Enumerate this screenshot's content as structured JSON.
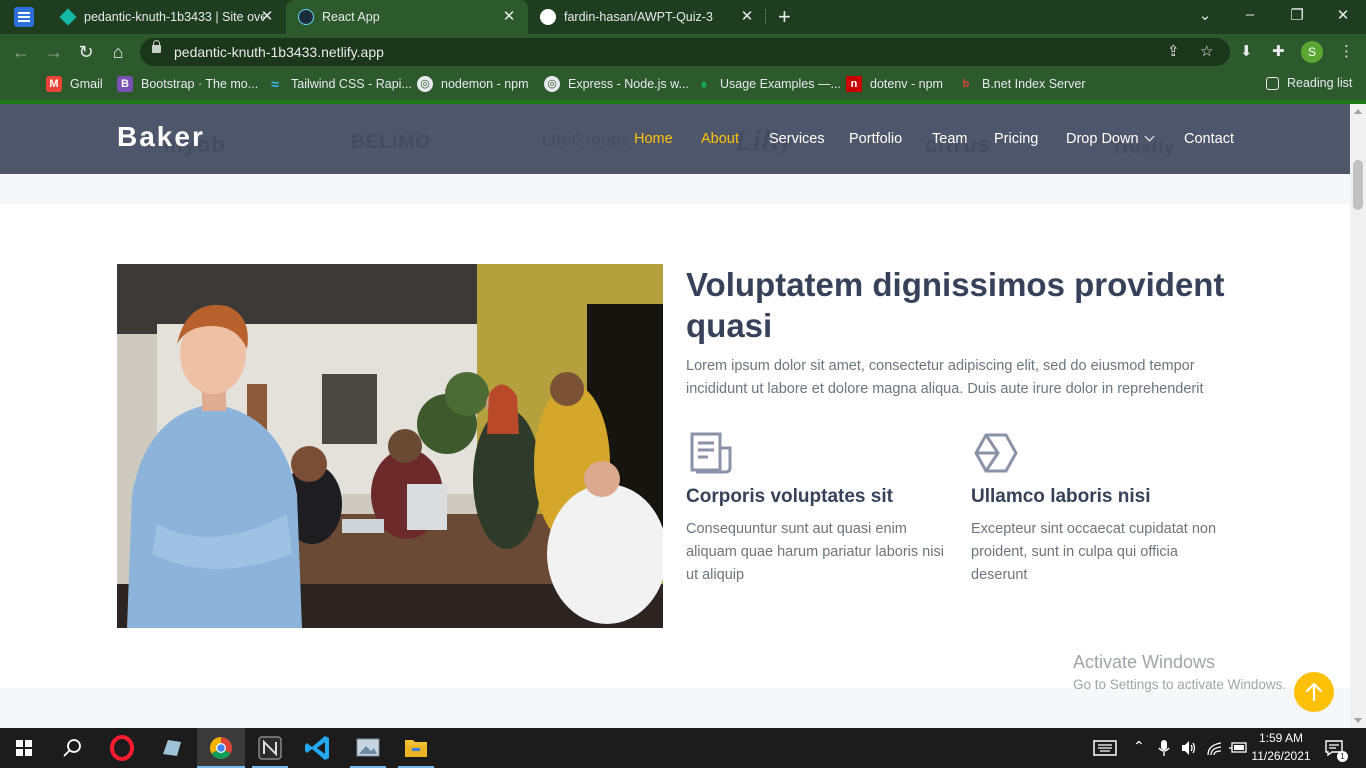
{
  "browser": {
    "tabs": [
      {
        "title": "pedantic-knuth-1b3433 | Site ove",
        "favicon": "netlify-icon",
        "active": false
      },
      {
        "title": "React App",
        "favicon": "react-icon",
        "active": true
      },
      {
        "title": "fardin-hasan/AWPT-Quiz-3",
        "favicon": "github-icon",
        "active": false
      }
    ],
    "url": "pedantic-knuth-1b3433.netlify.app",
    "profile_initial": "S",
    "bookmarks": [
      {
        "label": "Gmail",
        "icon": "gmail-icon"
      },
      {
        "label": "Bootstrap · The mo...",
        "icon": "bootstrap-icon"
      },
      {
        "label": "Tailwind CSS - Rapi...",
        "icon": "tailwind-icon"
      },
      {
        "label": "nodemon - npm",
        "icon": "globe-icon"
      },
      {
        "label": "Express - Node.js w...",
        "icon": "globe-icon"
      },
      {
        "label": "Usage Examples —...",
        "icon": "leaf-icon"
      },
      {
        "label": "dotenv - npm",
        "icon": "npm-icon"
      },
      {
        "label": "B.net Index Server",
        "icon": "bnet-icon"
      }
    ],
    "reading_list": "Reading list"
  },
  "site": {
    "brand": "Baker",
    "nav": [
      "Home",
      "About",
      "Services",
      "Portfolio",
      "Team",
      "Pricing",
      "Drop Down",
      "Contact"
    ],
    "active_nav": [
      "Home",
      "About"
    ],
    "client_logos": [
      "myob",
      "BELIMO",
      "LifeGroups",
      "Lilly",
      "citrus",
      "Trustly"
    ],
    "about": {
      "title": "Voluptatem dignissimos provident quasi",
      "lead": "Lorem ipsum dolor sit amet, consectetur adipiscing elit, sed do eiusmod tempor incididunt ut labore et dolore magna aliqua. Duis aute irure dolor in reprehenderit",
      "features": [
        {
          "icon": "receipt-icon",
          "title": "Corporis voluptates sit",
          "text": "Consequuntur sunt aut quasi enim aliquam quae harum pariatur laboris nisi ut aliquip"
        },
        {
          "icon": "cube-icon",
          "title": "Ullamco laboris nisi",
          "text": "Excepteur sint occaecat cupidatat non proident, sunt in culpa qui officia deserunt"
        }
      ]
    }
  },
  "overlay": {
    "activate_title": "Activate Windows",
    "activate_sub": "Go to Settings to activate Windows."
  },
  "taskbar": {
    "time": "1:59 AM",
    "date": "11/26/2021"
  },
  "colors": {
    "accent": "#ffc107",
    "header_bg": "#4e566b",
    "heading": "#37415a",
    "browser_frame": "#2d5a2d"
  }
}
